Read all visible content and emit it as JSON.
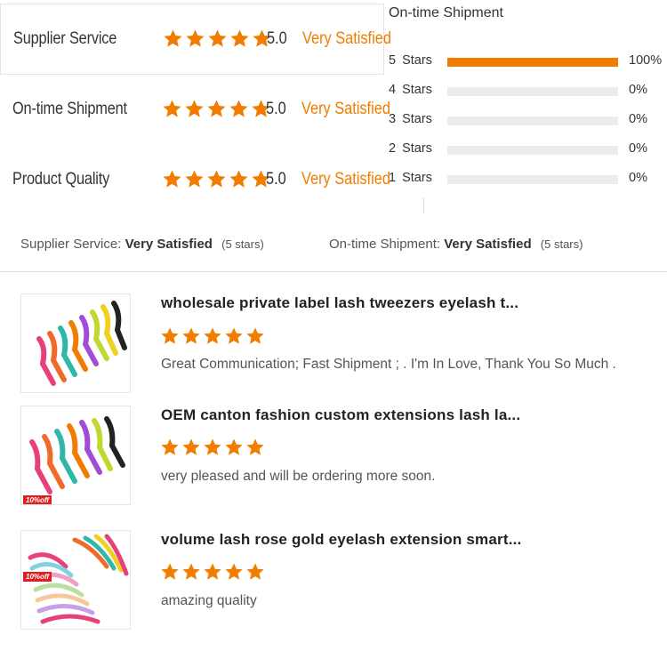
{
  "ratings": [
    {
      "label": "Supplier Service",
      "score": "5.0",
      "verdict": "Very Satisfied",
      "stars": 5
    },
    {
      "label": "On-time Shipment",
      "score": "5.0",
      "verdict": "Very Satisfied",
      "stars": 5
    },
    {
      "label": "Product Quality",
      "score": "5.0",
      "verdict": "Very Satisfied",
      "stars": 5
    }
  ],
  "histogram": {
    "title": "On-time Shipment",
    "rows": [
      {
        "label": "5 Stars",
        "percent": "100%",
        "fraction": 1.0
      },
      {
        "label": "4 Stars",
        "percent": "0%",
        "fraction": 0
      },
      {
        "label": "3 Stars",
        "percent": "0%",
        "fraction": 0
      },
      {
        "label": "2 Stars",
        "percent": "0%",
        "fraction": 0
      },
      {
        "label": "1 Stars",
        "percent": "0%",
        "fraction": 0
      }
    ]
  },
  "summary": {
    "supplier_label": "Supplier Service:",
    "supplier_value": "Very Satisfied",
    "supplier_stars": "(5 stars)",
    "shipment_label": "On-time Shipment:",
    "shipment_value": "Very Satisfied",
    "shipment_stars": "(5 stars)"
  },
  "reviews": [
    {
      "title": "wholesale private label lash tweezers eyelash t...",
      "stars": 5,
      "comment": "Great Communication; Fast Shipment ;   . I'm In Love, Thank You So Much .",
      "badge": ""
    },
    {
      "title": "OEM canton fashion custom extensions lash la...",
      "stars": 5,
      "comment": "very pleased and will be ordering more soon.",
      "badge": "10%off"
    },
    {
      "title": "volume lash rose gold eyelash extension smart...",
      "stars": 5,
      "comment": "amazing quality",
      "badge": "10%off"
    }
  ],
  "colors": {
    "accent": "#f07c00",
    "track": "#ececef",
    "badge": "#e02020"
  },
  "icons": {
    "star": "star-icon"
  }
}
